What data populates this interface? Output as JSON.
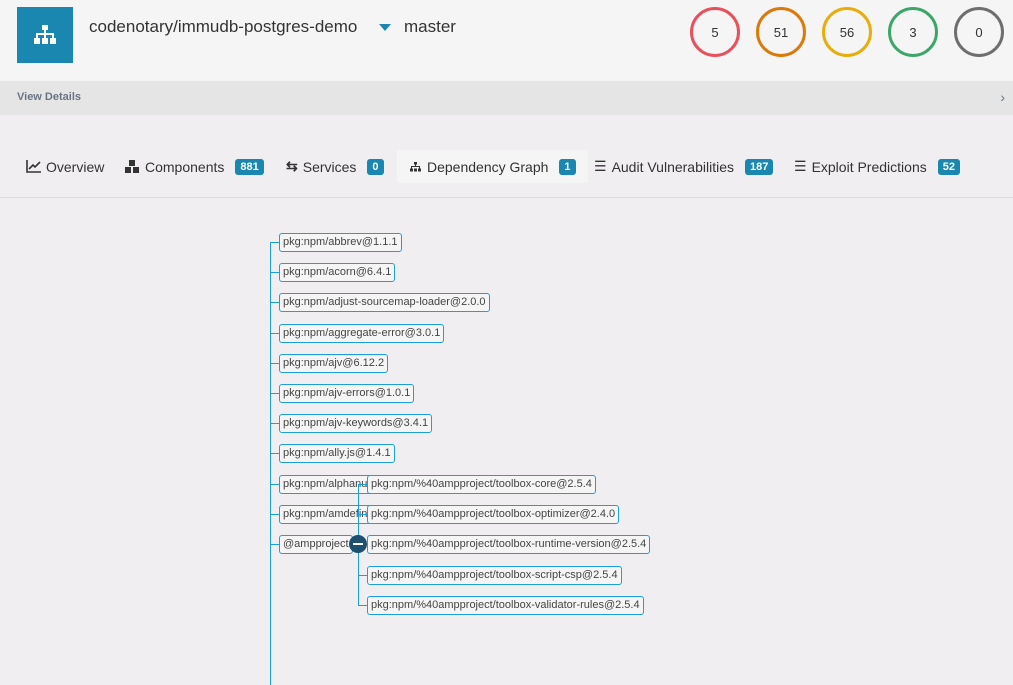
{
  "header": {
    "project": "codenotary/immudb-postgres-demo",
    "branch": "master",
    "severity_counts": [
      {
        "value": "5",
        "color": "#e8505b"
      },
      {
        "value": "51",
        "color": "#d97a0a"
      },
      {
        "value": "56",
        "color": "#e8ad0a"
      },
      {
        "value": "3",
        "color": "#3ea66a"
      },
      {
        "value": "0",
        "color": "#6e6e6e"
      }
    ]
  },
  "details": {
    "label": "View Details"
  },
  "tabs": [
    {
      "label": "Overview",
      "icon": "chart-line-icon"
    },
    {
      "label": "Components",
      "badge": "881",
      "icon": "cubes-icon"
    },
    {
      "label": "Services",
      "badge": "0",
      "icon": "exchange-icon"
    },
    {
      "label": "Dependency Graph",
      "badge": "1",
      "icon": "sitemap-icon",
      "active": true
    },
    {
      "label": "Audit Vulnerabilities",
      "badge": "187",
      "icon": "list-icon"
    },
    {
      "label": "Exploit Predictions",
      "badge": "52",
      "icon": "list-icon"
    }
  ],
  "tree": {
    "nodes": [
      "pkg:npm/abbrev@1.1.1",
      "pkg:npm/acorn@6.4.1",
      "pkg:npm/adjust-sourcemap-loader@2.0.0",
      "pkg:npm/aggregate-error@3.0.1",
      "pkg:npm/ajv@6.12.2",
      "pkg:npm/ajv-errors@1.0.1",
      "pkg:npm/ajv-keywords@3.4.1",
      "pkg:npm/ally.js@1.4.1",
      "pkg:npm/alphanum-sort@1.0.2",
      "pkg:npm/amdefine@1.0.1"
    ],
    "group": {
      "label": "@ampproject",
      "expanded": true,
      "children": [
        "pkg:npm/%40ampproject/toolbox-core@2.5.4",
        "pkg:npm/%40ampproject/toolbox-optimizer@2.4.0",
        "pkg:npm/%40ampproject/toolbox-runtime-version@2.5.4",
        "pkg:npm/%40ampproject/toolbox-script-csp@2.5.4",
        "pkg:npm/%40ampproject/toolbox-validator-rules@2.5.4"
      ]
    }
  }
}
